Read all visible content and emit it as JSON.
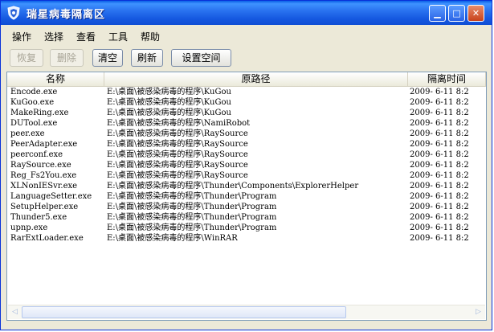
{
  "window": {
    "title": "瑞星病毒隔离区"
  },
  "titlebar": {
    "minimize": "▁",
    "maximize": "□",
    "close": "✕"
  },
  "menu": [
    "操作",
    "选择",
    "查看",
    "工具",
    "帮助"
  ],
  "toolbar": {
    "restore": "恢复",
    "delete": "删除",
    "clear": "清空",
    "refresh": "刷新",
    "settings": "设置空间"
  },
  "table": {
    "columns": [
      "名称",
      "原路径",
      "隔离时间"
    ],
    "rows": [
      {
        "name": "Encode.exe",
        "path": "E:\\桌面\\被感染病毒的程序\\KuGou",
        "time": "2009- 6-11  8:2"
      },
      {
        "name": "KuGoo.exe",
        "path": "E:\\桌面\\被感染病毒的程序\\KuGou",
        "time": "2009- 6-11  8:2"
      },
      {
        "name": "MakeRing.exe",
        "path": "E:\\桌面\\被感染病毒的程序\\KuGou",
        "time": "2009- 6-11  8:2"
      },
      {
        "name": "DUTool.exe",
        "path": "E:\\桌面\\被感染病毒的程序\\NamiRobot",
        "time": "2009- 6-11  8:2"
      },
      {
        "name": "peer.exe",
        "path": "E:\\桌面\\被感染病毒的程序\\RaySource",
        "time": "2009- 6-11  8:2"
      },
      {
        "name": "PeerAdapter.exe",
        "path": "E:\\桌面\\被感染病毒的程序\\RaySource",
        "time": "2009- 6-11  8:2"
      },
      {
        "name": "peerconf.exe",
        "path": "E:\\桌面\\被感染病毒的程序\\RaySource",
        "time": "2009- 6-11  8:2"
      },
      {
        "name": "RaySource.exe",
        "path": "E:\\桌面\\被感染病毒的程序\\RaySource",
        "time": "2009- 6-11  8:2"
      },
      {
        "name": "Reg_Fs2You.exe",
        "path": "E:\\桌面\\被感染病毒的程序\\RaySource",
        "time": "2009- 6-11  8:2"
      },
      {
        "name": "XLNonIESvr.exe",
        "path": "E:\\桌面\\被感染病毒的程序\\Thunder\\Components\\ExplorerHelper",
        "time": "2009- 6-11  8:2"
      },
      {
        "name": "LanguageSetter.exe",
        "path": "E:\\桌面\\被感染病毒的程序\\Thunder\\Program",
        "time": "2009- 6-11  8:2"
      },
      {
        "name": "SetupHelper.exe",
        "path": "E:\\桌面\\被感染病毒的程序\\Thunder\\Program",
        "time": "2009- 6-11  8:2"
      },
      {
        "name": "Thunder5.exe",
        "path": "E:\\桌面\\被感染病毒的程序\\Thunder\\Program",
        "time": "2009- 6-11  8:2"
      },
      {
        "name": "upnp.exe",
        "path": "E:\\桌面\\被感染病毒的程序\\Thunder\\Program",
        "time": "2009- 6-11  8:2"
      },
      {
        "name": "RarExtLoader.exe",
        "path": "E:\\桌面\\被感染病毒的程序\\WinRAR",
        "time": "2009- 6-11  8:2"
      }
    ]
  },
  "scrollbar": {
    "left_arrow": "◁",
    "right_arrow": "▷"
  }
}
